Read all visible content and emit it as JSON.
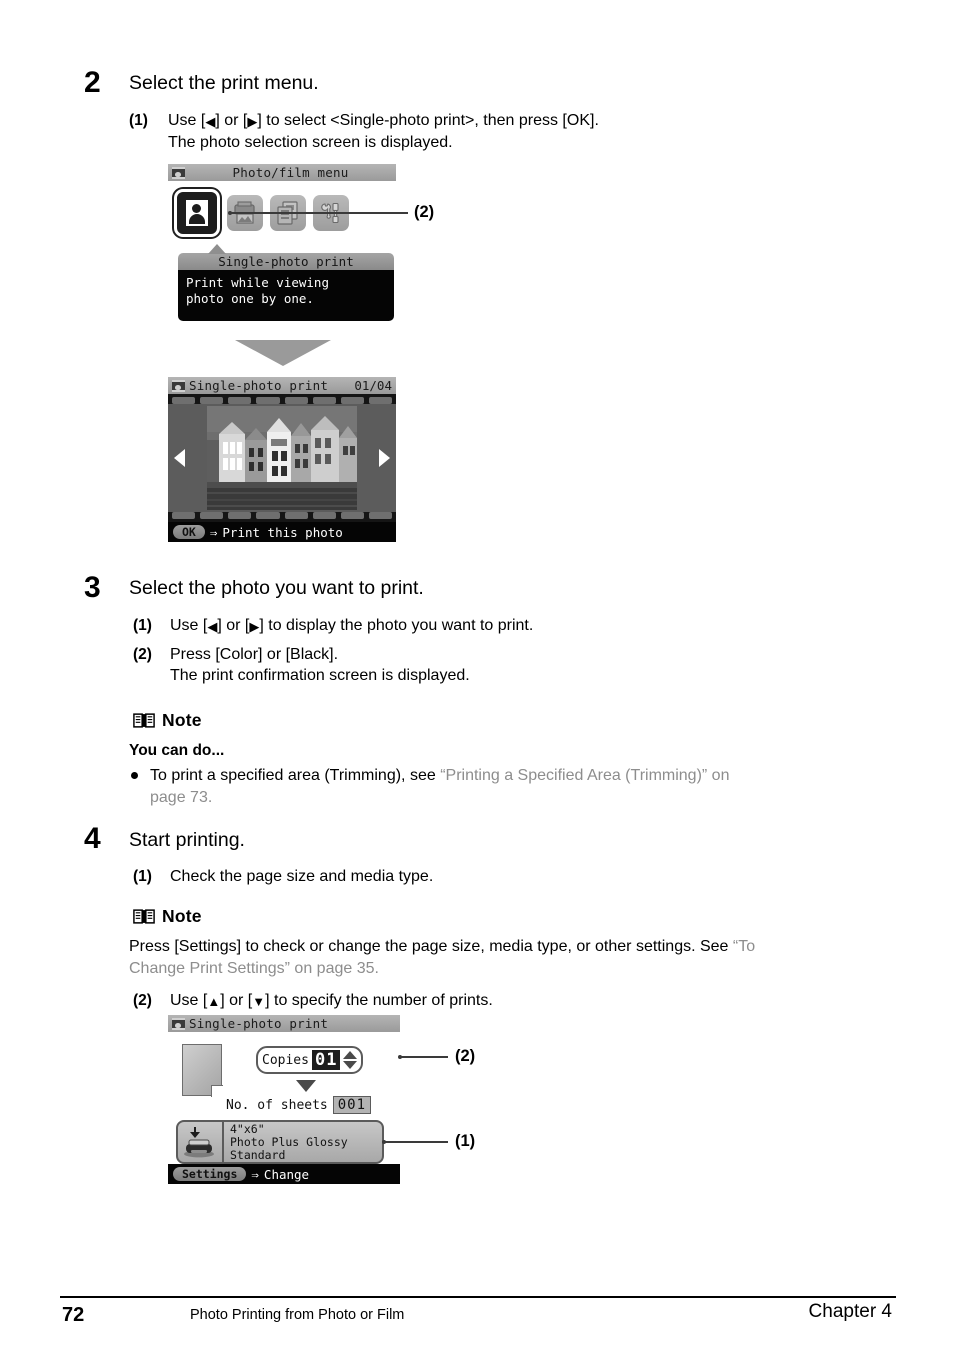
{
  "steps": [
    {
      "number": "2",
      "title": "Select the print menu.",
      "items": [
        {
          "label": "(1)",
          "line1_pre": "Use [",
          "line1_mid": "] or [",
          "line1_post": "] to select <Single-photo print>, then press [OK].",
          "line2": "The photo selection screen is displayed."
        }
      ]
    },
    {
      "number": "3",
      "title": "Select the photo you want to print.",
      "items": [
        {
          "label": "(1)",
          "text": "to display the photo you want to print."
        },
        {
          "label": "(2)",
          "line1": "Press [Color] or [Black].",
          "line2": "The print confirmation screen is displayed."
        }
      ]
    },
    {
      "number": "4",
      "title": "Start printing.",
      "items": [
        {
          "label": "(1)",
          "text": "Check the page size and media type."
        },
        {
          "label": "(2)",
          "text": "to specify the number of prints."
        }
      ]
    }
  ],
  "use_word": "Use [",
  "or_word": "] or [",
  "close_bracket": "]",
  "notes": [
    {
      "heading": "Note",
      "subheading": "You can do...",
      "bullet_black": "To print a specified area (Trimming), see ",
      "bullet_gray_1": "“Printing a Specified Area (Trimming)” on",
      "bullet_gray_2": "page 73."
    },
    {
      "heading": "Note",
      "body_black": "Press [Settings] to check or change the page size, media type, or other settings. See ",
      "body_gray_1": "“To",
      "body_gray_2": "Change Print Settings” on page 35."
    }
  ],
  "menu_screen": {
    "title": "Photo/film menu",
    "icons": [
      {
        "name": "single-photo-print",
        "selected": true
      },
      {
        "name": "photo-print",
        "selected": false
      },
      {
        "name": "layout-print",
        "selected": false
      },
      {
        "name": "maintenance",
        "selected": false
      }
    ],
    "callout": "(2)",
    "balloon": {
      "title": "Single-photo print",
      "line1": "Print while viewing",
      "line2": "photo one by one."
    }
  },
  "photo_screen": {
    "title": "Single-photo print",
    "counter": "01/04",
    "footer_button": "OK",
    "footer_arrow": "⇒",
    "footer_text": "Print this photo"
  },
  "settings_screen": {
    "title": "Single-photo print",
    "copies_label": "Copies",
    "copies_value": "01",
    "sheets_label": "No. of sheets",
    "sheets_value": "001",
    "media": {
      "size": "4\"x6\"",
      "type": "Photo Plus Glossy",
      "quality": "Standard"
    },
    "footer_button": "Settings",
    "footer_arrow": "⇒",
    "footer_text": "Change",
    "callout_copies": "(2)",
    "callout_media": "(1)"
  },
  "footer": {
    "page_number": "72",
    "section": "Photo Printing from Photo or Film",
    "chapter": "Chapter 4"
  },
  "colors": {
    "text": "#000000",
    "reference_gray": "#8d8d8d",
    "lcd_dark": "#050505",
    "lcd_gray": "#9a9a9a"
  }
}
